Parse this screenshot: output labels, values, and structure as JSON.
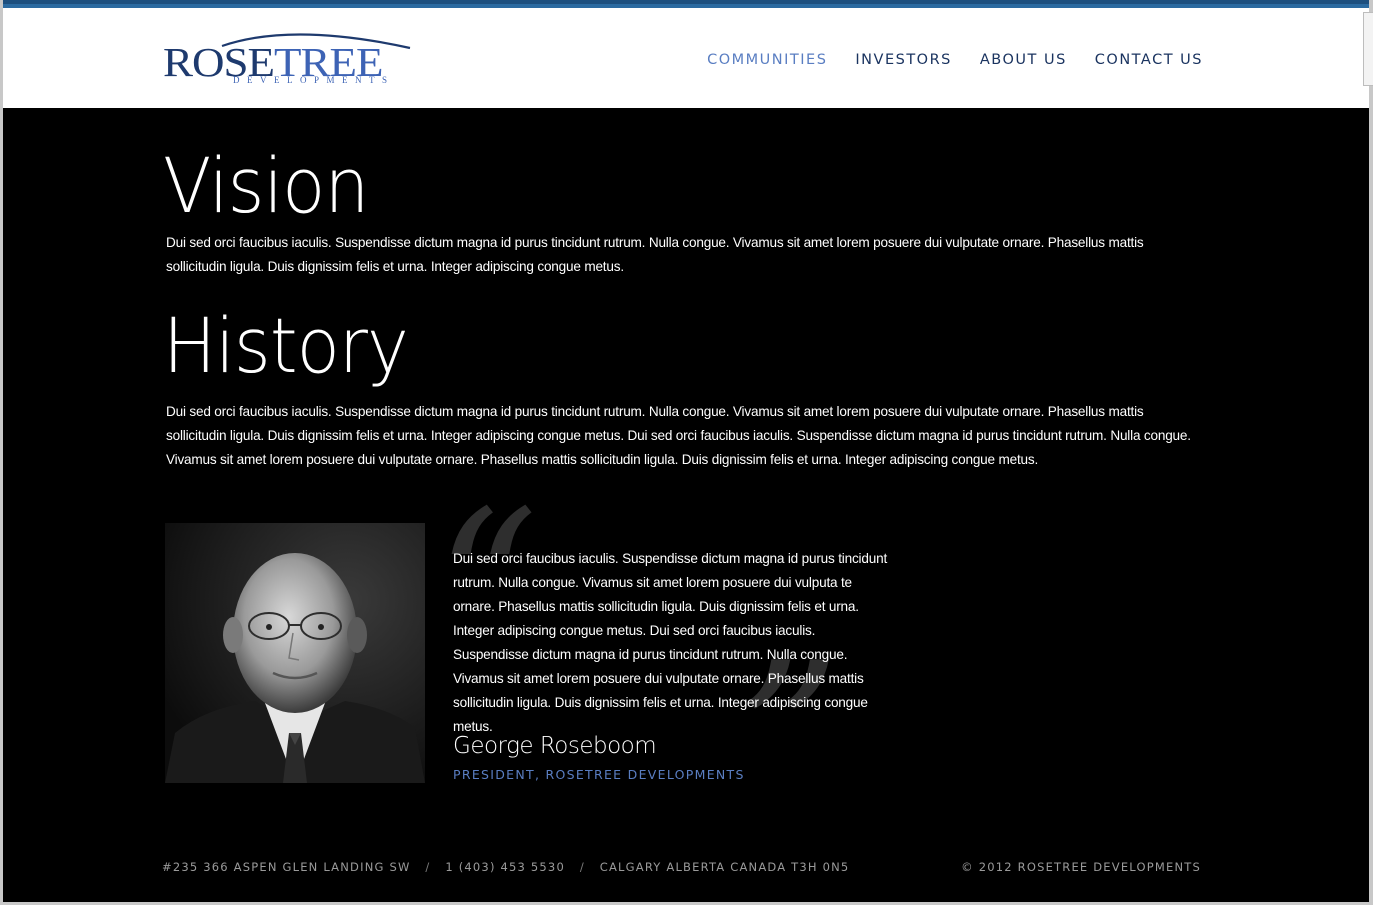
{
  "logo": {
    "main_rose": "ROSE",
    "main_tree": "TREE",
    "sub": "DEVELOPMENTS"
  },
  "nav": {
    "items": [
      {
        "label": "COMMUNITIES",
        "active": true
      },
      {
        "label": "INVESTORS",
        "active": false
      },
      {
        "label": "ABOUT US",
        "active": false
      },
      {
        "label": "CONTACT US",
        "active": false
      }
    ]
  },
  "vision": {
    "heading": "Vision",
    "body": "Dui sed orci faucibus iaculis. Suspendisse dictum magna id purus tincidunt rutrum. Nulla congue. Vivamus sit amet lorem posuere dui vulputate ornare. Phasellus mattis sollicitudin ligula. Duis dignissim felis et urna. Integer adipiscing congue metus."
  },
  "history": {
    "heading": "History",
    "body": "Dui sed orci faucibus iaculis. Suspendisse dictum magna id purus tincidunt rutrum. Nulla congue. Vivamus sit amet lorem posuere dui vulputate ornare. Phasellus mattis sollicitudin ligula. Duis dignissim felis et urna. Integer adipiscing congue metus. Dui sed orci faucibus iaculis. Suspendisse dictum magna id purus tincidunt rutrum. Nulla congue. Vivamus sit amet lorem posuere dui vulputate ornare. Phasellus mattis sollicitudin ligula. Duis dignissim felis et urna. Integer adipiscing congue metus."
  },
  "testimonial": {
    "open_mark": "“",
    "close_mark": "”",
    "quote": "Dui sed orci faucibus iaculis. Suspendisse dictum magna id purus tincidunt rutrum. Nulla congue. Vivamus sit amet lorem posuere dui vulputa te ornare. Phasellus mattis sollicitudin ligula. Duis dignissim felis et urna. Integer adipiscing congue metus. Dui sed orci faucibus iaculis. Suspendisse dictum magna id purus tincidunt rutrum. Nulla congue. Vivamus sit amet lorem posuere dui vulputate ornare. Phasellus mattis sollicitudin ligula. Duis dignissim felis et urna. Integer adipiscing congue metus.",
    "name": "George Roseboom",
    "title": "PRESIDENT, ROSETREE DEVELOPMENTS"
  },
  "footer": {
    "address": "#235 366 ASPEN GLEN LANDING SW",
    "separator": "/",
    "phone": "1 (403) 453 5530",
    "city": "CALGARY ALBERTA CANADA T3H 0N5",
    "copyright": "© 2012 ROSETREE DEVELOPMENTS"
  },
  "colors": {
    "brand_dark": "#1e3a6e",
    "brand_light": "#3d63b5",
    "accent": "#5a7ec2",
    "top_bar": "#1d4f7e"
  }
}
